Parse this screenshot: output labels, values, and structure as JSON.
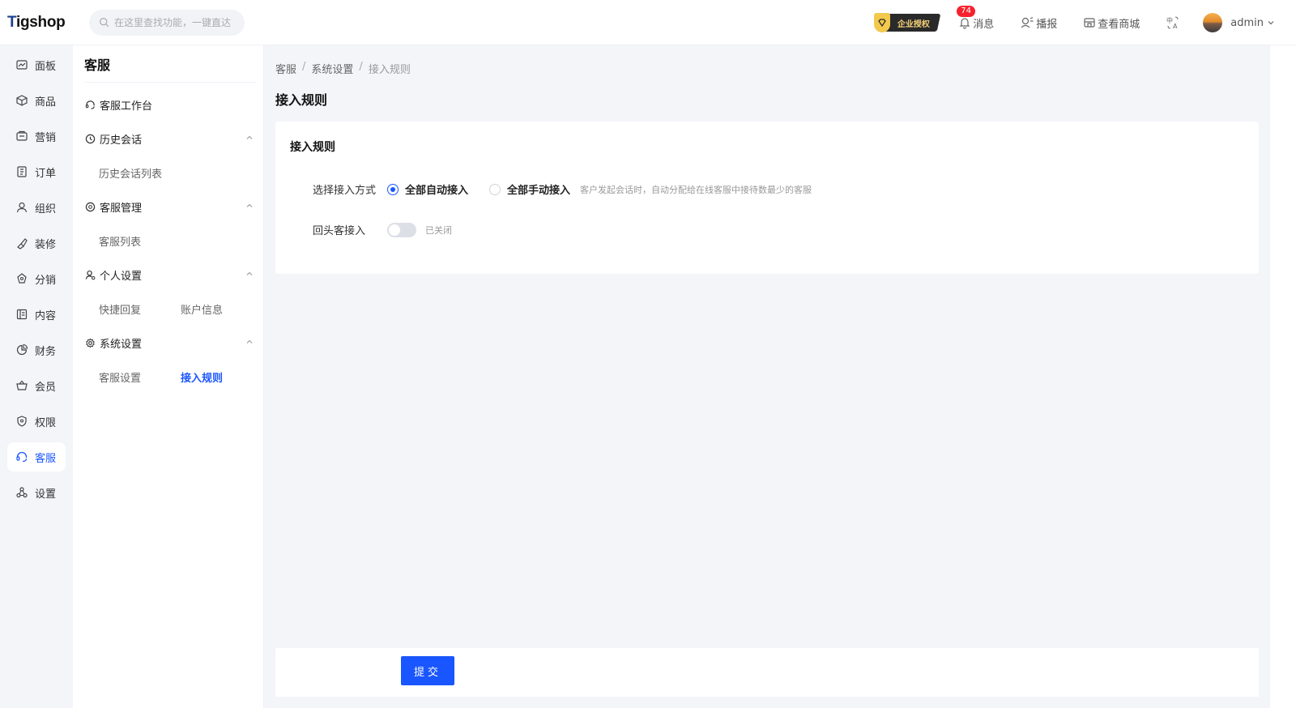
{
  "app": {
    "logo": "Tigshop"
  },
  "search": {
    "placeholder": "在这里查找功能，一键直达"
  },
  "header": {
    "license_label": "企业授权",
    "messages_label": "消息",
    "messages_count": "74",
    "broadcast_label": "播报",
    "view_store_label": "查看商城",
    "username": "admin"
  },
  "leftnav": {
    "items": [
      {
        "label": "面板",
        "icon": "dashboard-icon"
      },
      {
        "label": "商品",
        "icon": "box-icon"
      },
      {
        "label": "营销",
        "icon": "ticket-icon"
      },
      {
        "label": "订单",
        "icon": "order-icon"
      },
      {
        "label": "组织",
        "icon": "user-icon"
      },
      {
        "label": "装修",
        "icon": "brush-icon"
      },
      {
        "label": "分销",
        "icon": "share-icon"
      },
      {
        "label": "内容",
        "icon": "content-icon"
      },
      {
        "label": "财务",
        "icon": "pie-icon"
      },
      {
        "label": "会员",
        "icon": "basket-icon"
      },
      {
        "label": "权限",
        "icon": "shield-icon"
      },
      {
        "label": "客服",
        "icon": "headset-icon",
        "active": true
      },
      {
        "label": "设置",
        "icon": "settings-icon"
      }
    ]
  },
  "submenu": {
    "title": "客服",
    "workbench": "客服工作台",
    "history": {
      "label": "历史会话",
      "items": [
        "历史会话列表"
      ]
    },
    "manage": {
      "label": "客服管理",
      "items": [
        "客服列表"
      ]
    },
    "personal": {
      "label": "个人设置",
      "items": [
        "快捷回复",
        "账户信息"
      ]
    },
    "system": {
      "label": "系统设置",
      "items": [
        "客服设置",
        "接入规则"
      ],
      "active_item": "接入规则"
    }
  },
  "breadcrumb": [
    "客服",
    "系统设置",
    "接入规则"
  ],
  "page": {
    "title": "接入规则",
    "card_title": "接入规则",
    "access_mode_label": "选择接入方式",
    "option_auto": "全部自动接入",
    "option_manual": "全部手动接入",
    "selected_option": "全部自动接入",
    "hint": "客户发起会话时，自动分配给在线客服中接待数最少的客服",
    "returning_label": "回头客接入",
    "returning_enabled": false,
    "returning_status": "已关闭",
    "submit_label": "提交"
  },
  "colors": {
    "accent": "#1a56ff",
    "badge": "#f5222d",
    "background": "#f3f5f9"
  }
}
